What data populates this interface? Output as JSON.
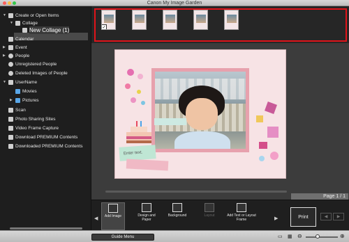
{
  "window": {
    "title": "Canon My Image Garden"
  },
  "sidebar": {
    "items": [
      {
        "label": "Create or Open Items",
        "level": 0,
        "arrow": "▼",
        "icon": "create-icon"
      },
      {
        "label": "Collage",
        "level": 1,
        "arrow": "▼",
        "icon": "collage-icon"
      },
      {
        "label": "New Collage (1)",
        "level": 2,
        "arrow": "",
        "icon": "collage-doc-icon",
        "selected": true
      },
      {
        "label": "Calendar",
        "level": 0,
        "arrow": "",
        "icon": "calendar-icon"
      },
      {
        "label": "Event",
        "level": 0,
        "arrow": "▶",
        "icon": "event-icon"
      },
      {
        "label": "People",
        "level": 0,
        "arrow": "▶",
        "icon": "people-icon"
      },
      {
        "label": "Unregistered People",
        "level": 0,
        "arrow": "",
        "icon": "unregistered-people-icon"
      },
      {
        "label": "Deleted Images of People",
        "level": 0,
        "arrow": "",
        "icon": "deleted-people-icon"
      },
      {
        "label": "UserName",
        "level": 0,
        "arrow": "▼",
        "icon": "computer-icon"
      },
      {
        "label": "Movies",
        "level": 1,
        "arrow": "",
        "icon": "folder-icon"
      },
      {
        "label": "Pictures",
        "level": 1,
        "arrow": "▶",
        "icon": "folder-icon"
      },
      {
        "label": "Scan",
        "level": 0,
        "arrow": "",
        "icon": "scan-icon"
      },
      {
        "label": "Photo Sharing Sites",
        "level": 0,
        "arrow": "",
        "icon": "sharing-icon"
      },
      {
        "label": "Video Frame Capture",
        "level": 0,
        "arrow": "",
        "icon": "video-icon"
      },
      {
        "label": "Download PREMIUM Contents",
        "level": 0,
        "arrow": "",
        "icon": "download-icon"
      },
      {
        "label": "Downloaded PREMIUM Contents",
        "level": 0,
        "arrow": "",
        "icon": "downloaded-icon"
      }
    ]
  },
  "filmstrip": {
    "count": 5,
    "checked_index": 0
  },
  "canvas": {
    "page_indicator": "Page 1 / 1",
    "sticky_text": "Enter text."
  },
  "toolbar": {
    "tools": [
      {
        "label": "Add Image",
        "icon": "add-image-icon",
        "active": true,
        "disabled": false
      },
      {
        "label": "Design and Paper",
        "icon": "design-paper-icon",
        "active": false,
        "disabled": false
      },
      {
        "label": "Background",
        "icon": "background-icon",
        "active": false,
        "disabled": false
      },
      {
        "label": "Layout",
        "icon": "layout-icon",
        "active": false,
        "disabled": true
      },
      {
        "label": "Add Text or Layout Frame",
        "icon": "add-text-icon",
        "active": false,
        "disabled": false
      }
    ],
    "print_label": "Print"
  },
  "statusbar": {
    "guide_label": "Guide Menu"
  },
  "colors": {
    "highlight_frame": "#e0141a",
    "page_bg": "#f7e3e5",
    "photo_border": "#e7a1ad"
  }
}
